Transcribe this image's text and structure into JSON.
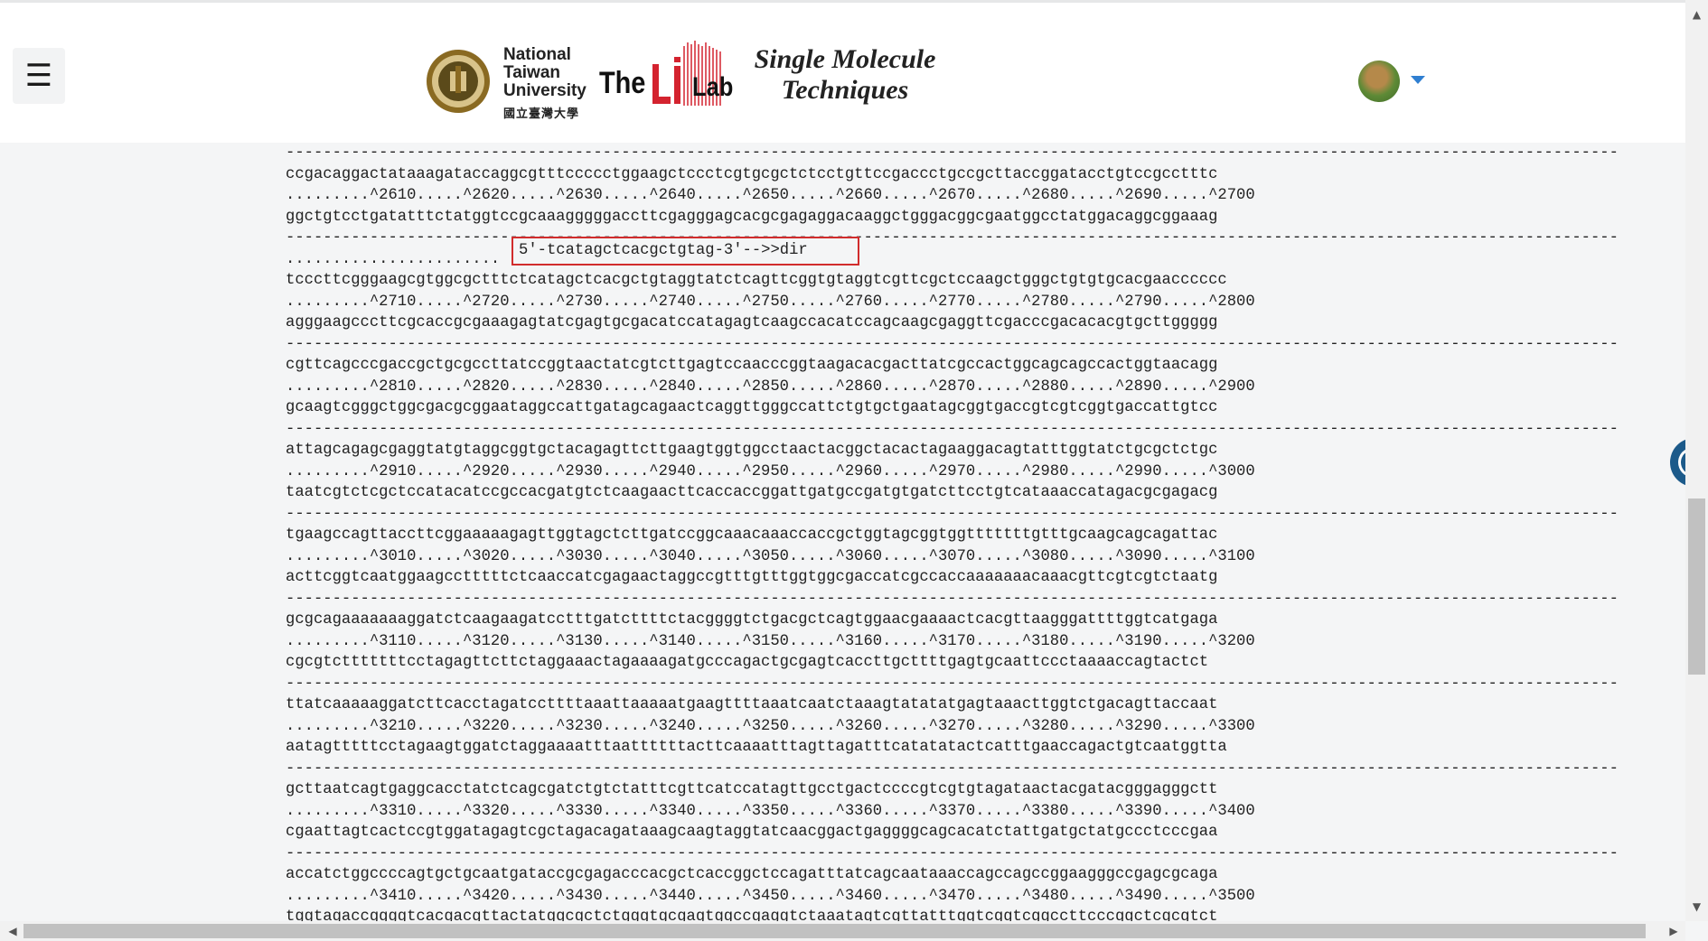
{
  "header": {
    "menu_icon": "☰",
    "university_lines": [
      "National",
      "Taiwan",
      "University"
    ],
    "university_cn": "國立臺灣大學",
    "lab_the": "The",
    "lab_name": "Lab",
    "lab_tagline_lines": [
      "Single Molecule",
      "Techniques"
    ]
  },
  "primer_label": "5'-tcatagctcacgctgtag-3'-->>dir",
  "sequence_lines": [
    "-----------------------------------------------------------------------------------------------------------------------------------------------",
    "ccgacaggactataaagataccaggcgtttccccctggaagctccctcgtgcgctctcctgttccgaccctgccgcttaccggatacctgtccgcctttc",
    ".........^2610.....^2620.....^2630.....^2640.....^2650.....^2660.....^2670.....^2680.....^2690.....^2700",
    "ggctgtcctgatatttctatggtccgcaaagggggaccttcgagggagcacgcgagaggacaaggctgggacggcgaatggcctatggacaggcggaaag",
    "-----------------------------------------------------------------------------------------------------------------------------------------------",
    ".......................",
    "tcccttcgggaagcgtggcgctttctcatagctcacgctgtaggtatctcagttcggtgtaggtcgttcgctccaagctgggctgtgtgcacgaacccccc",
    ".........^2710.....^2720.....^2730.....^2740.....^2750.....^2760.....^2770.....^2780.....^2790.....^2800",
    "agggaagcccttcgcaccgcgaaagagtatcgagtgcgacatccatagagtcaagccacatccagcaagcgaggttcgacccgacacacgtgcttggggg",
    "-----------------------------------------------------------------------------------------------------------------------------------------------",
    "cgttcagcccgaccgctgcgccttatccggtaactatcgtcttgagtccaacccggtaagacacgacttatcgccactggcagcagccactggtaacagg",
    ".........^2810.....^2820.....^2830.....^2840.....^2850.....^2860.....^2870.....^2880.....^2890.....^2900",
    "gcaagtcgggctggcgacgcggaataggccattgatagcagaactcaggttgggccattctgtgctgaatagcggtgaccgtcgtcggtgaccattgtcc",
    "-----------------------------------------------------------------------------------------------------------------------------------------------",
    "attagcagagcgaggtatgtaggcggtgctacagagttcttgaagtggtggcctaactacggctacactagaaggacagtatttggtatctgcgctctgc",
    ".........^2910.....^2920.....^2930.....^2940.....^2950.....^2960.....^2970.....^2980.....^2990.....^3000",
    "taatcgtctcgctccatacatccgccacgatgtctcaagaacttcaccaccggattgatgccgatgtgatcttcctgtcataaaccatagacgcgagacg",
    "-----------------------------------------------------------------------------------------------------------------------------------------------",
    "tgaagccagttaccttcggaaaaagagttggtagctcttgatccggcaaacaaaccaccgctggtagcggtggtttttttgtttgcaagcagcagattac",
    ".........^3010.....^3020.....^3030.....^3040.....^3050.....^3060.....^3070.....^3080.....^3090.....^3100",
    "acttcggtcaatggaagcctttttctcaaccatcgagaactaggccgtttgtttggtggcgaccatcgccaccaaaaaaacaaacgttcgtcgtctaatg",
    "-----------------------------------------------------------------------------------------------------------------------------------------------",
    "gcgcagaaaaaaaggatctcaagaagatcctttgatcttttctacggggtctgacgctcagtggaacgaaaactcacgttaagggattttggtcatgaga",
    ".........^3110.....^3120.....^3130.....^3140.....^3150.....^3160.....^3170.....^3180.....^3190.....^3200",
    "cgcgtctttttttcctagagttcttctaggaaactagaaaagatgcccagactgcgagtcaccttgcttttgagtgcaattccctaaaaccagtactct",
    "-----------------------------------------------------------------------------------------------------------------------------------------------",
    "ttatcaaaaaggatcttcacctagatccttttaaattaaaaatgaagttttaaatcaatctaaagtatatatgagtaaacttggtctgacagttaccaat",
    ".........^3210.....^3220.....^3230.....^3240.....^3250.....^3260.....^3270.....^3280.....^3290.....^3300",
    "aatagtttttcctagaagtggatctaggaaaatttaattttttacttcaaaatttagttagatttcatatatactcatttgaaccagactgtcaatggtta",
    "-----------------------------------------------------------------------------------------------------------------------------------------------",
    "gcttaatcagtgaggcacctatctcagcgatctgtctatttcgttcatccatagttgcctgactccccgtcgtgtagataactacgatacgggagggctt",
    ".........^3310.....^3320.....^3330.....^3340.....^3350.....^3360.....^3370.....^3380.....^3390.....^3400",
    "cgaattagtcactccgtggatagagtcgctagacagataaagcaagtaggtatcaacggactgaggggcagcacatctattgatgctatgccctcccgaa",
    "-----------------------------------------------------------------------------------------------------------------------------------------------",
    "accatctggccccagtgctgcaatgataccgcgagacccacgctcaccggctccagatttatcagcaataaaccagccagccggaagggccgagcgcaga",
    ".........^3410.....^3420.....^3430.....^3440.....^3450.....^3460.....^3470.....^3480.....^3490.....^3500",
    "tggtagaccggggtcacgacgttactatggcgctctgggtgcgagtggccgaggtctaaatagtcgttatttggtcggtcggccttcccggctcgcgtct"
  ],
  "colors": {
    "primer_box": "#d12c2c",
    "caret": "#2f7fd1",
    "background": "#f4f5f6"
  },
  "icons": [
    "menu-icon",
    "avatar-icon",
    "caret-down-icon",
    "scroll-up-icon",
    "scroll-down-icon",
    "scroll-left-icon",
    "scroll-right-icon",
    "accessibility-icon"
  ]
}
